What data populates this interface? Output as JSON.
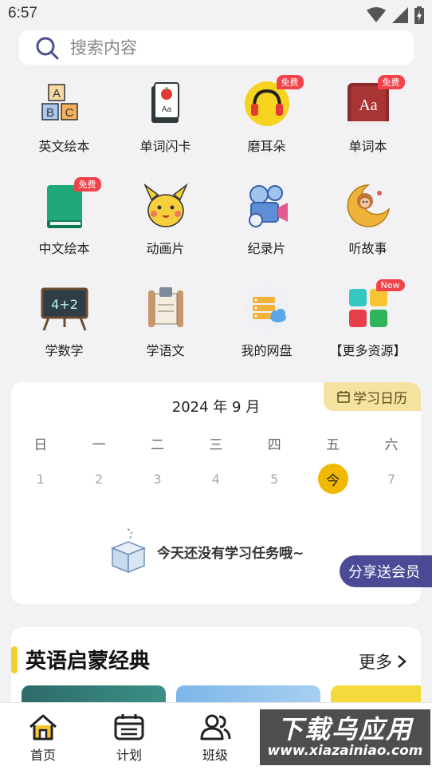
{
  "status": {
    "time": "6:57"
  },
  "search": {
    "placeholder": "搜索内容"
  },
  "grid": [
    {
      "label": "英文绘本",
      "icon": "abc-blocks-icon",
      "badge": ""
    },
    {
      "label": "单词闪卡",
      "icon": "flashcards-icon",
      "badge": ""
    },
    {
      "label": "磨耳朵",
      "icon": "headphones-icon",
      "badge": "免费"
    },
    {
      "label": "单词本",
      "icon": "dictionary-icon",
      "badge": "免费"
    },
    {
      "label": "中文绘本",
      "icon": "green-book-icon",
      "badge": "免费"
    },
    {
      "label": "动画片",
      "icon": "pikachu-icon",
      "badge": ""
    },
    {
      "label": "纪录片",
      "icon": "film-camera-icon",
      "badge": ""
    },
    {
      "label": "听故事",
      "icon": "moon-monkey-icon",
      "badge": ""
    },
    {
      "label": "学数学",
      "icon": "chalkboard-icon",
      "badge": ""
    },
    {
      "label": "学语文",
      "icon": "scroll-icon",
      "badge": ""
    },
    {
      "label": "我的网盘",
      "icon": "cloud-drive-icon",
      "badge": ""
    },
    {
      "label": "【更多资源】",
      "icon": "more-grid-icon",
      "badge": "New"
    }
  ],
  "calendar": {
    "month": "2024 年 9 月",
    "tag": "学习日历",
    "weekdays": [
      "日",
      "一",
      "二",
      "三",
      "四",
      "五",
      "六"
    ],
    "days": [
      "1",
      "2",
      "3",
      "4",
      "5",
      "今",
      "7"
    ],
    "empty_text": "今天还没有学习任务哦~"
  },
  "share_label": "分享送会员",
  "classics": {
    "title": "英语启蒙经典",
    "more": "更多"
  },
  "tabs": [
    {
      "label": "首页",
      "icon": "home-icon"
    },
    {
      "label": "计划",
      "icon": "calendar-icon"
    },
    {
      "label": "班级",
      "icon": "users-icon"
    }
  ],
  "watermark": {
    "line1": "下载乌应用",
    "line2": "www.xiazainiao.com"
  },
  "colors": {
    "accent": "#f0b800",
    "share": "#4b4a97",
    "badge": "#f0434a"
  }
}
